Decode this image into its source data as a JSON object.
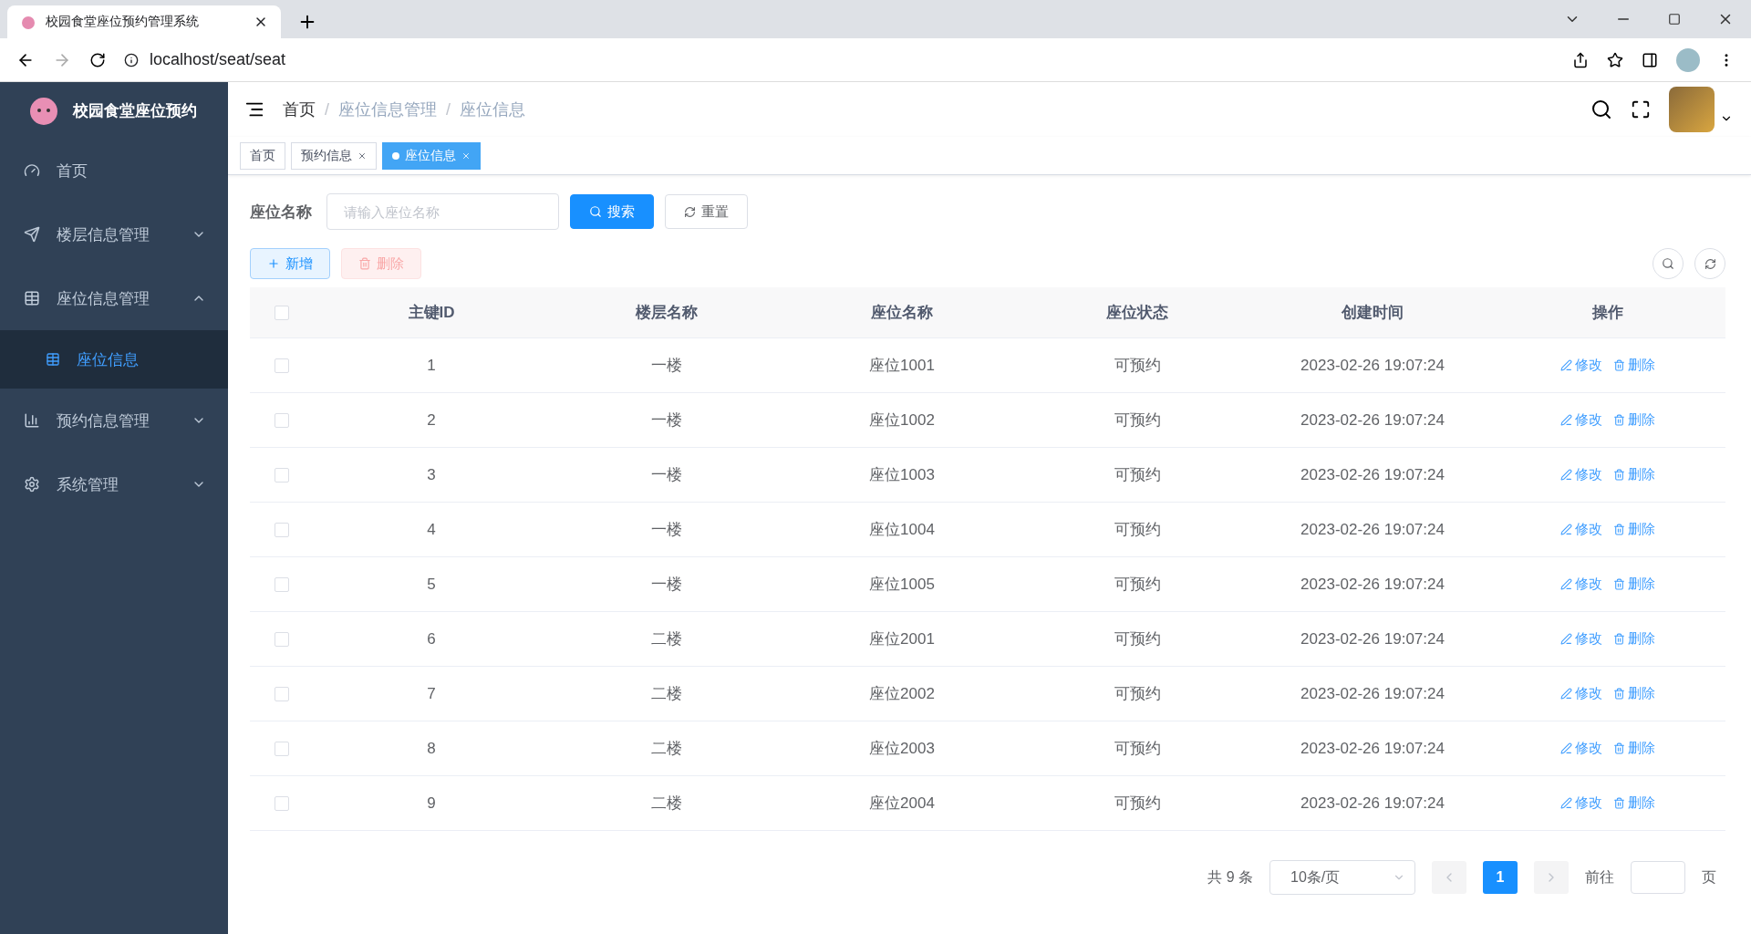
{
  "browser": {
    "tab_title": "校园食堂座位预约管理系统",
    "url": "localhost/seat/seat"
  },
  "sidebar": {
    "title": "校园食堂座位预约",
    "items": [
      {
        "label": "首页"
      },
      {
        "label": "楼层信息管理",
        "expanded": false
      },
      {
        "label": "座位信息管理",
        "expanded": true,
        "children": [
          {
            "label": "座位信息",
            "selected": true
          }
        ]
      },
      {
        "label": "预约信息管理",
        "expanded": false
      },
      {
        "label": "系统管理",
        "expanded": false
      }
    ]
  },
  "breadcrumb": [
    {
      "label": "首页"
    },
    {
      "separator": "/",
      "label": "座位信息管理"
    },
    {
      "separator": "/",
      "label": "座位信息"
    }
  ],
  "tags": [
    {
      "label": "首页",
      "selected": false,
      "closable": false
    },
    {
      "label": "预约信息",
      "selected": false,
      "closable": true
    },
    {
      "label": "座位信息",
      "selected": true,
      "closable": true
    }
  ],
  "search": {
    "label": "座位名称",
    "placeholder": "请输入座位名称",
    "search_button": "搜索",
    "reset_button": "重置"
  },
  "toolbar": {
    "add": {
      "label": "新增",
      "disabled": false
    },
    "delete": {
      "label": "删除",
      "disabled": true
    }
  },
  "table": {
    "columns": [
      "主键ID",
      "楼层名称",
      "座位名称",
      "座位状态",
      "创建时间",
      "操作"
    ],
    "header_checked": false,
    "rows": [
      {
        "checked": false,
        "cells": [
          "1",
          "一楼",
          "座位1001",
          "可预约",
          "2023-02-26 19:07:24"
        ],
        "actions": [
          "修改",
          "删除"
        ]
      },
      {
        "checked": false,
        "cells": [
          "2",
          "一楼",
          "座位1002",
          "可预约",
          "2023-02-26 19:07:24"
        ],
        "actions": [
          "修改",
          "删除"
        ]
      },
      {
        "checked": false,
        "cells": [
          "3",
          "一楼",
          "座位1003",
          "可预约",
          "2023-02-26 19:07:24"
        ],
        "actions": [
          "修改",
          "删除"
        ]
      },
      {
        "checked": false,
        "cells": [
          "4",
          "一楼",
          "座位1004",
          "可预约",
          "2023-02-26 19:07:24"
        ],
        "actions": [
          "修改",
          "删除"
        ]
      },
      {
        "checked": false,
        "cells": [
          "5",
          "一楼",
          "座位1005",
          "可预约",
          "2023-02-26 19:07:24"
        ],
        "actions": [
          "修改",
          "删除"
        ]
      },
      {
        "checked": false,
        "cells": [
          "6",
          "二楼",
          "座位2001",
          "可预约",
          "2023-02-26 19:07:24"
        ],
        "actions": [
          "修改",
          "删除"
        ]
      },
      {
        "checked": false,
        "cells": [
          "7",
          "二楼",
          "座位2002",
          "可预约",
          "2023-02-26 19:07:24"
        ],
        "actions": [
          "修改",
          "删除"
        ]
      },
      {
        "checked": false,
        "cells": [
          "8",
          "二楼",
          "座位2003",
          "可预约",
          "2023-02-26 19:07:24"
        ],
        "actions": [
          "修改",
          "删除"
        ]
      },
      {
        "checked": false,
        "cells": [
          "9",
          "二楼",
          "座位2004",
          "可预约",
          "2023-02-26 19:07:24"
        ],
        "actions": [
          "修改",
          "删除"
        ]
      }
    ]
  },
  "pagination": {
    "total": "共 9 条",
    "page_size": "10条/页",
    "pages": [
      {
        "label": "1",
        "selected": true
      }
    ],
    "goto": "前往",
    "goto_suffix": "页"
  }
}
